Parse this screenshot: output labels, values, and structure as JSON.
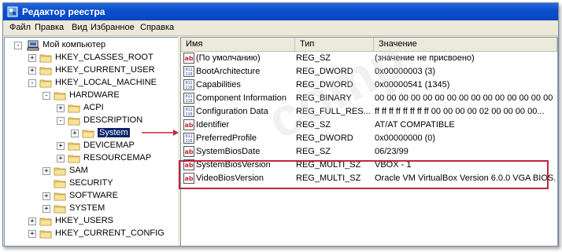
{
  "window": {
    "title": "Редактор реестра"
  },
  "menu": [
    "Файл",
    "Правка",
    "Вид",
    "Избранное",
    "Справка"
  ],
  "tree": {
    "root": "Мой компьютер",
    "items": [
      {
        "label": "HKEY_CLASSES_ROOT",
        "expander": "+"
      },
      {
        "label": "HKEY_CURRENT_USER",
        "expander": "+"
      },
      {
        "label": "HKEY_LOCAL_MACHINE",
        "expander": "-"
      },
      {
        "label": "HARDWARE",
        "expander": "-"
      },
      {
        "label": "ACPI",
        "expander": "+"
      },
      {
        "label": "DESCRIPTION",
        "expander": "-"
      },
      {
        "label": "System",
        "expander": "+",
        "selected": true
      },
      {
        "label": "DEVICEMAP",
        "expander": "+"
      },
      {
        "label": "RESOURCEMAP",
        "expander": "+"
      },
      {
        "label": "SAM",
        "expander": "+"
      },
      {
        "label": "SECURITY",
        "expander": ""
      },
      {
        "label": "SOFTWARE",
        "expander": "+"
      },
      {
        "label": "SYSTEM",
        "expander": "+"
      },
      {
        "label": "HKEY_USERS",
        "expander": "+"
      },
      {
        "label": "HKEY_CURRENT_CONFIG",
        "expander": "+"
      }
    ]
  },
  "columns": [
    "Имя",
    "Тип",
    "Значение"
  ],
  "rows": [
    {
      "name": "(По умолчанию)",
      "type": "REG_SZ",
      "value": "(значение не присвоено)",
      "icon": "string-value-icon"
    },
    {
      "name": "BootArchitecture",
      "type": "REG_DWORD",
      "value": "0x00000003 (3)",
      "icon": "binary-value-icon"
    },
    {
      "name": "Capabilities",
      "type": "REG_DWORD",
      "value": "0x00000541 (1345)",
      "icon": "binary-value-icon"
    },
    {
      "name": "Component Information",
      "type": "REG_BINARY",
      "value": "00 00 00 00 00 00 00 00 00 00 00 00 00 00 00 00...",
      "icon": "binary-value-icon"
    },
    {
      "name": "Configuration Data",
      "type": "REG_FULL_RES...",
      "value": "ff ff ff ff ff ff ff ff 00 00 00 00 02 00 00 00 00...",
      "icon": "binary-value-icon"
    },
    {
      "name": "Identifier",
      "type": "REG_SZ",
      "value": "AT/AT COMPATIBLE",
      "icon": "string-value-icon"
    },
    {
      "name": "PreferredProfile",
      "type": "REG_DWORD",
      "value": "0x00000000 (0)",
      "icon": "binary-value-icon"
    },
    {
      "name": "SystemBiosDate",
      "type": "REG_SZ",
      "value": "06/23/99",
      "icon": "string-value-icon"
    },
    {
      "name": "SystemBiosVersion",
      "type": "REG_MULTI_SZ",
      "value": "VBOX   - 1",
      "icon": "string-value-icon"
    },
    {
      "name": "VideoBiosVersion",
      "type": "REG_MULTI_SZ",
      "value": "Oracle VM VirtualBox Version 6.0.0 VGA BIOS...",
      "icon": "string-value-icon"
    }
  ],
  "watermark": "comp",
  "colors": {
    "title_bar": "#0a4fd0",
    "highlight_box": "#c0283a",
    "selection": "#0a246a",
    "folder": "#f5d572"
  }
}
